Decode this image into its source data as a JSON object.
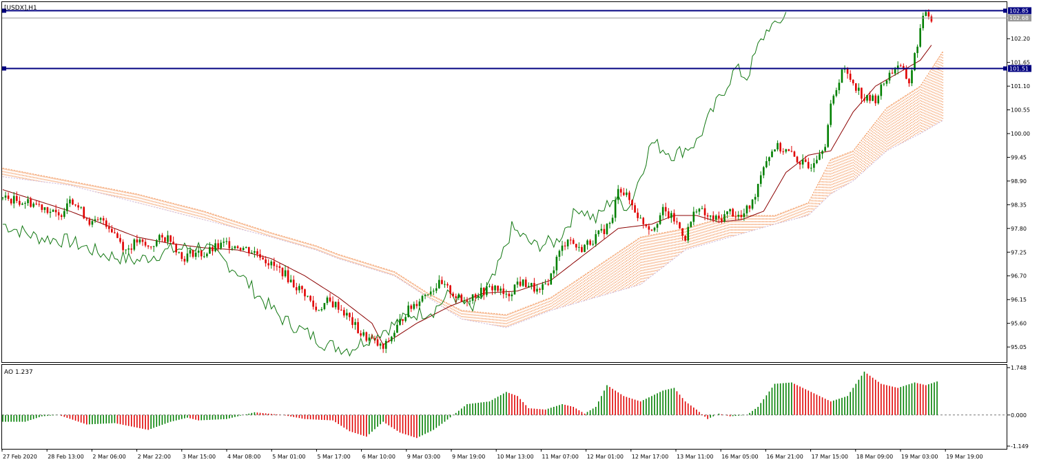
{
  "window": {
    "symbol_label": "[USDX],H1",
    "ao_label": "AO 1.237"
  },
  "colors": {
    "background": "#ffffff",
    "frame": "#000000",
    "bull": "#007f00",
    "bear": "#e00000",
    "ma": "#8b0000",
    "chikou": "#117711",
    "cloud_bull": "#f4a06a",
    "cloud_bear": "#c8b4dc",
    "hline": "#000080",
    "axis_text": "#000000"
  },
  "chart_data": [
    {
      "type": "candlestick",
      "title": "[USDX],H1",
      "ylim": [
        94.7,
        103.05
      ],
      "y_ticks": [
        "102.20",
        "101.65",
        "101.10",
        "100.55",
        "100.00",
        "99.45",
        "98.90",
        "98.35",
        "97.80",
        "97.25",
        "96.70",
        "96.15",
        "95.60",
        "95.05"
      ],
      "x_tick_labels": [
        "27 Feb 2020",
        "28 Feb 13:00",
        "2 Mar 06:00",
        "2 Mar 22:00",
        "3 Mar 15:00",
        "4 Mar 08:00",
        "5 Mar 01:00",
        "5 Mar 17:00",
        "6 Mar 10:00",
        "9 Mar 03:00",
        "9 Mar 19:00",
        "10 Mar 13:00",
        "11 Mar 07:00",
        "12 Mar 01:00",
        "12 Mar 17:00",
        "13 Mar 11:00",
        "16 Mar 05:00",
        "16 Mar 21:00",
        "17 Mar 15:00",
        "18 Mar 09:00",
        "19 Mar 03:00",
        "19 Mar 19:00"
      ],
      "close_path": [
        [
          0,
          98.5
        ],
        [
          10,
          98.4
        ],
        [
          15,
          98.3
        ],
        [
          20,
          98.05
        ],
        [
          24,
          98.55
        ],
        [
          28,
          98.2
        ],
        [
          32,
          97.9
        ],
        [
          36,
          98.0
        ],
        [
          40,
          97.7
        ],
        [
          44,
          97.3
        ],
        [
          48,
          97.5
        ],
        [
          52,
          97.35
        ],
        [
          56,
          97.55
        ],
        [
          60,
          97.6
        ],
        [
          64,
          97.1
        ],
        [
          68,
          97.25
        ],
        [
          72,
          97.2
        ],
        [
          76,
          97.35
        ],
        [
          80,
          97.45
        ],
        [
          84,
          97.4
        ],
        [
          88,
          97.3
        ],
        [
          92,
          97.2
        ],
        [
          96,
          96.95
        ],
        [
          100,
          96.8
        ],
        [
          104,
          96.5
        ],
        [
          108,
          96.3
        ],
        [
          112,
          95.9
        ],
        [
          116,
          96.1
        ],
        [
          120,
          96.0
        ],
        [
          124,
          95.7
        ],
        [
          128,
          95.35
        ],
        [
          132,
          95.2
        ],
        [
          136,
          95.0
        ],
        [
          140,
          95.4
        ],
        [
          144,
          95.85
        ],
        [
          148,
          96.1
        ],
        [
          152,
          96.35
        ],
        [
          156,
          96.5
        ],
        [
          160,
          96.35
        ],
        [
          164,
          96.1
        ],
        [
          168,
          96.25
        ],
        [
          172,
          96.35
        ],
        [
          176,
          96.45
        ],
        [
          180,
          96.2
        ],
        [
          184,
          96.55
        ],
        [
          188,
          96.5
        ],
        [
          192,
          96.3
        ],
        [
          196,
          96.7
        ],
        [
          198,
          97.1
        ],
        [
          202,
          97.6
        ],
        [
          206,
          97.3
        ],
        [
          210,
          97.5
        ],
        [
          214,
          97.7
        ],
        [
          218,
          98.0
        ],
        [
          220,
          98.8
        ],
        [
          224,
          98.45
        ],
        [
          228,
          98.0
        ],
        [
          232,
          97.8
        ],
        [
          236,
          98.2
        ],
        [
          240,
          98.0
        ],
        [
          244,
          97.6
        ],
        [
          248,
          98.3
        ],
        [
          252,
          98.05
        ],
        [
          256,
          98.0
        ],
        [
          260,
          98.2
        ],
        [
          264,
          98.05
        ],
        [
          268,
          98.4
        ],
        [
          272,
          99.3
        ],
        [
          276,
          99.7
        ],
        [
          280,
          99.6
        ],
        [
          284,
          99.4
        ],
        [
          288,
          99.2
        ],
        [
          290,
          99.4
        ],
        [
          294,
          99.8
        ],
        [
          296,
          100.6
        ],
        [
          300,
          101.5
        ],
        [
          304,
          101.2
        ],
        [
          308,
          100.8
        ],
        [
          312,
          100.8
        ],
        [
          316,
          101.3
        ],
        [
          320,
          101.6
        ],
        [
          324,
          101.2
        ],
        [
          328,
          102.4
        ],
        [
          330,
          102.85
        ],
        [
          332,
          102.68
        ]
      ],
      "moving_average": {
        "period": "",
        "points": [
          [
            0,
            98.7
          ],
          [
            12,
            98.45
          ],
          [
            24,
            98.2
          ],
          [
            36,
            97.9
          ],
          [
            48,
            97.6
          ],
          [
            60,
            97.45
          ],
          [
            72,
            97.35
          ],
          [
            84,
            97.3
          ],
          [
            96,
            97.1
          ],
          [
            108,
            96.7
          ],
          [
            120,
            96.2
          ],
          [
            132,
            95.6
          ],
          [
            136,
            95.1
          ],
          [
            148,
            95.6
          ],
          [
            160,
            96.0
          ],
          [
            172,
            96.3
          ],
          [
            184,
            96.35
          ],
          [
            196,
            96.6
          ],
          [
            208,
            97.2
          ],
          [
            220,
            97.8
          ],
          [
            232,
            97.9
          ],
          [
            240,
            98.1
          ],
          [
            248,
            98.1
          ],
          [
            256,
            97.95
          ],
          [
            264,
            98.0
          ],
          [
            272,
            98.2
          ],
          [
            280,
            99.1
          ],
          [
            288,
            99.5
          ],
          [
            296,
            99.6
          ],
          [
            304,
            100.5
          ],
          [
            312,
            101.1
          ],
          [
            320,
            101.4
          ],
          [
            328,
            101.7
          ],
          [
            332,
            102.05
          ]
        ]
      },
      "chikou_span": {
        "points": [
          [
            0,
            97.9
          ],
          [
            12,
            97.6
          ],
          [
            24,
            97.5
          ],
          [
            36,
            97.2
          ],
          [
            48,
            97.05
          ],
          [
            60,
            97.3
          ],
          [
            72,
            97.4
          ],
          [
            84,
            96.8
          ],
          [
            92,
            96.2
          ],
          [
            100,
            95.7
          ],
          [
            108,
            95.4
          ],
          [
            116,
            95.1
          ],
          [
            124,
            95.0
          ],
          [
            132,
            95.3
          ],
          [
            138,
            95.5
          ],
          [
            146,
            95.8
          ],
          [
            154,
            95.9
          ],
          [
            160,
            96.3
          ],
          [
            168,
            95.9
          ],
          [
            176,
            96.7
          ],
          [
            182,
            97.8
          ],
          [
            190,
            97.4
          ],
          [
            198,
            97.5
          ],
          [
            206,
            98.3
          ],
          [
            212,
            98.0
          ],
          [
            218,
            98.5
          ],
          [
            224,
            98.3
          ],
          [
            232,
            99.8
          ],
          [
            240,
            99.5
          ],
          [
            248,
            99.8
          ],
          [
            256,
            100.8
          ],
          [
            262,
            101.5
          ],
          [
            266,
            101.3
          ],
          [
            270,
            102.0
          ],
          [
            274,
            102.5
          ],
          [
            276,
            102.45
          ],
          [
            280,
            102.8
          ]
        ]
      },
      "ichimoku_cloud": {
        "span_a": [
          [
            0,
            99.2
          ],
          [
            24,
            98.9
          ],
          [
            48,
            98.6
          ],
          [
            72,
            98.2
          ],
          [
            96,
            97.7
          ],
          [
            112,
            97.4
          ],
          [
            120,
            97.2
          ],
          [
            140,
            96.8
          ],
          [
            152,
            96.3
          ],
          [
            164,
            95.9
          ],
          [
            180,
            95.8
          ],
          [
            196,
            96.2
          ],
          [
            212,
            96.9
          ],
          [
            228,
            97.6
          ],
          [
            244,
            97.8
          ],
          [
            260,
            98.1
          ],
          [
            276,
            98.1
          ],
          [
            288,
            98.4
          ],
          [
            296,
            99.4
          ],
          [
            304,
            99.6
          ],
          [
            316,
            100.6
          ],
          [
            328,
            101.1
          ],
          [
            336,
            101.9
          ]
        ],
        "span_b": [
          [
            0,
            99.0
          ],
          [
            24,
            98.8
          ],
          [
            48,
            98.4
          ],
          [
            72,
            98.0
          ],
          [
            96,
            97.6
          ],
          [
            112,
            97.3
          ],
          [
            120,
            97.1
          ],
          [
            140,
            96.7
          ],
          [
            152,
            96.2
          ],
          [
            164,
            95.7
          ],
          [
            180,
            95.5
          ],
          [
            196,
            95.9
          ],
          [
            212,
            96.2
          ],
          [
            228,
            96.5
          ],
          [
            244,
            97.3
          ],
          [
            260,
            97.6
          ],
          [
            276,
            97.9
          ],
          [
            288,
            98.1
          ],
          [
            296,
            98.6
          ],
          [
            304,
            98.9
          ],
          [
            316,
            99.6
          ],
          [
            328,
            100.0
          ],
          [
            336,
            100.3
          ]
        ]
      },
      "horizontal_lines": [
        {
          "label": "102.85",
          "value": 102.85
        },
        {
          "label": "101.51",
          "value": 101.51
        }
      ],
      "current_price_label": "102.68"
    },
    {
      "type": "bar",
      "title": "AO 1.237",
      "ylim": [
        -1.149,
        1.748
      ],
      "y_ticks": [
        "1.748",
        "0.000",
        "-1.149"
      ],
      "current_value": 1.237,
      "profile": [
        [
          0,
          -0.25
        ],
        [
          8,
          -0.25
        ],
        [
          14,
          -0.05
        ],
        [
          20,
          0.0
        ],
        [
          30,
          -0.35
        ],
        [
          40,
          -0.3
        ],
        [
          52,
          -0.55
        ],
        [
          60,
          -0.25
        ],
        [
          66,
          -0.1
        ],
        [
          70,
          -0.2
        ],
        [
          80,
          -0.15
        ],
        [
          90,
          0.1
        ],
        [
          100,
          0.0
        ],
        [
          108,
          -0.15
        ],
        [
          118,
          -0.2
        ],
        [
          124,
          -0.6
        ],
        [
          130,
          -0.8
        ],
        [
          136,
          -0.25
        ],
        [
          142,
          -0.65
        ],
        [
          148,
          -0.85
        ],
        [
          154,
          -0.55
        ],
        [
          158,
          -0.25
        ],
        [
          166,
          0.4
        ],
        [
          174,
          0.5
        ],
        [
          180,
          0.85
        ],
        [
          184,
          0.7
        ],
        [
          188,
          0.25
        ],
        [
          194,
          0.2
        ],
        [
          200,
          0.4
        ],
        [
          204,
          0.3
        ],
        [
          208,
          0.05
        ],
        [
          212,
          0.3
        ],
        [
          216,
          1.1
        ],
        [
          222,
          0.7
        ],
        [
          228,
          0.5
        ],
        [
          236,
          0.9
        ],
        [
          240,
          1.0
        ],
        [
          244,
          0.5
        ],
        [
          248,
          0.2
        ],
        [
          252,
          -0.15
        ],
        [
          256,
          0.05
        ],
        [
          260,
          -0.05
        ],
        [
          266,
          0.0
        ],
        [
          270,
          0.3
        ],
        [
          276,
          1.15
        ],
        [
          282,
          1.2
        ],
        [
          288,
          0.9
        ],
        [
          296,
          0.5
        ],
        [
          302,
          0.7
        ],
        [
          308,
          1.6
        ],
        [
          314,
          1.15
        ],
        [
          320,
          1.0
        ],
        [
          326,
          1.2
        ],
        [
          330,
          1.1
        ],
        [
          334,
          1.237
        ]
      ]
    }
  ]
}
